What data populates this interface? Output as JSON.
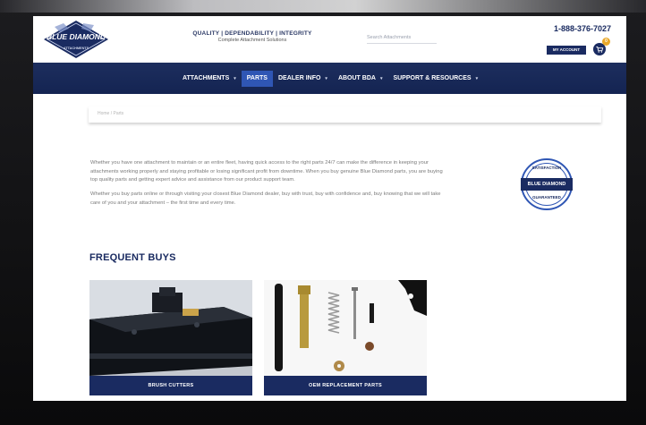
{
  "header": {
    "brand": "BLUE DIAMOND",
    "brand_sub": "ATTACHMENTS",
    "tagline": "QUALITY | DEPENDABILITY | INTEGRITY",
    "subtagline": "Complete Attachment Solutions",
    "search_placeholder": "Search Attachments",
    "phone": "1-888-376-7027",
    "my_account": "MY ACCOUNT",
    "cart_count": "0"
  },
  "nav": {
    "items": [
      {
        "label": "ATTACHMENTS",
        "caret": "▾"
      },
      {
        "label": "PARTS",
        "caret": ""
      },
      {
        "label": "DEALER INFO",
        "caret": "▾"
      },
      {
        "label": "ABOUT BDA",
        "caret": "▾"
      },
      {
        "label": "SUPPORT & RESOURCES",
        "caret": "▾"
      }
    ],
    "active_index": 1
  },
  "breadcrumb": "Home / Parts",
  "intro": {
    "p1": "Whether you have one attachment to maintain or an entire fleet, having quick access to the right parts 24/7 can make the difference in keeping your attachments working properly and staying profitable or losing significant profit from downtime. When you buy genuine Blue Diamond parts, you are buying top quality parts and getting expert advice and assistance from our product support team.",
    "p2": "Whether you buy parts online or through visiting your closest Blue Diamond dealer, buy with trust, buy with confidence and, buy knowing that we will take care of you and your attachment – the first time and every time."
  },
  "badge": {
    "top": "SATISFACTION",
    "middle": "BLUE DIAMOND",
    "bottom": "GUARANTEED"
  },
  "frequent_buys": {
    "title": "FREQUENT BUYS",
    "cards": [
      {
        "label": "BRUSH CUTTERS"
      },
      {
        "label": "OEM REPLACEMENT PARTS"
      }
    ]
  },
  "colors": {
    "navy": "#1a2b61",
    "active_blue": "#2f56b4",
    "gold": "#e9a92b"
  }
}
